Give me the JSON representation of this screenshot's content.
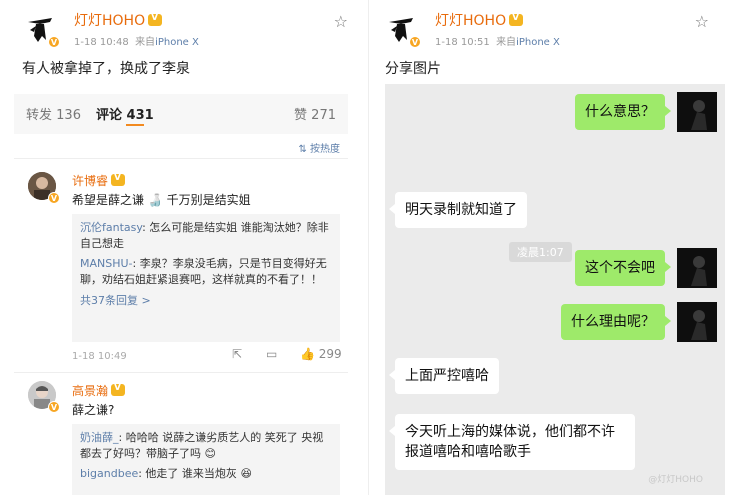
{
  "left_post": {
    "username": "灯灯HOHO",
    "date": "1-18 10:48",
    "source_prefix": "来自",
    "source": "iPhone X",
    "text": "有人被拿掉了，换成了李泉",
    "stats": {
      "repost_label": "转发",
      "repost_count": "136",
      "comment_label": "评论",
      "comment_count": "431",
      "like_label": "赞",
      "like_count": "271"
    },
    "sort_label": "按热度",
    "comments": [
      {
        "name": "许博睿",
        "text": "希望是薛之谦",
        "text_suffix": "千万别是结实姐",
        "replies": [
          {
            "user": "沉伦fantasy",
            "text": ": 怎么可能是结实姐 谁能淘汰她？除非自己想走"
          },
          {
            "user": "MANSHU-",
            "text": ": 李泉？李泉没毛病，只是节目变得好无聊，劝结石姐赶紧退赛吧，这样就真的不看了！！"
          }
        ],
        "more": "共37条回复 >",
        "time": "1-18 10:49",
        "likes": "299"
      },
      {
        "name": "高景瀚",
        "text": "薛之谦?",
        "replies": [
          {
            "user": "奶油薛_",
            "text": ": 哈哈哈  说薛之谦劣质艺人的  笑死了 央视都去了好吗？带脑子了吗"
          },
          {
            "user": "bigandbee",
            "text": ": 他走了 谁来当炮灰"
          }
        ]
      }
    ]
  },
  "right_post": {
    "username": "灯灯HOHO",
    "date": "1-18 10:51",
    "source_prefix": "来自",
    "source": "iPhone X",
    "text": "分享图片",
    "chat": {
      "time_chip": "凌晨1:07",
      "messages": [
        {
          "from": "me",
          "text": "什么意思？"
        },
        {
          "from": "other",
          "text": "明天录制就知道了"
        },
        {
          "from": "me",
          "text": "这个不会吧"
        },
        {
          "from": "me",
          "text": "什么理由呢？"
        },
        {
          "from": "other",
          "text": "上面严控嘻哈"
        },
        {
          "from": "other",
          "text": "今天听上海的媒体说，他们都不许报道嘻哈和嘻哈歌手"
        }
      ]
    },
    "watermark": "@灯灯HOHO"
  },
  "colors": {
    "orange": "#e86b0c",
    "link": "#5d7ea9",
    "wechat_green": "#9eea6a"
  }
}
